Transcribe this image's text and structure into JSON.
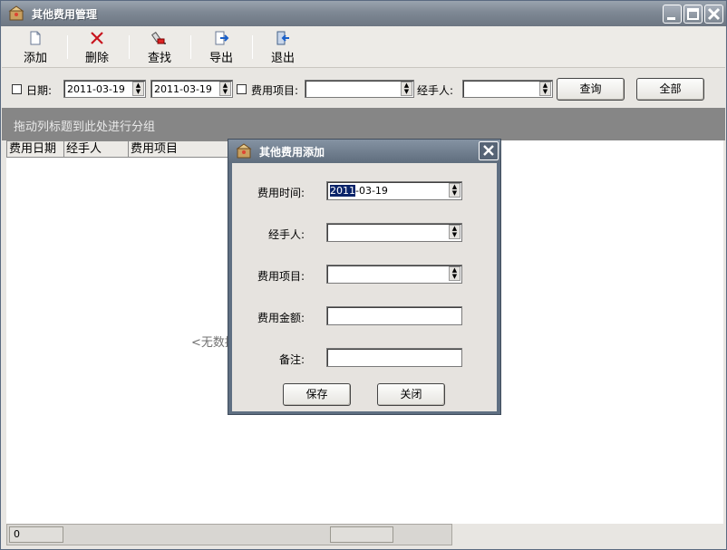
{
  "window": {
    "title": "其他费用管理"
  },
  "toolbar": {
    "add": "添加",
    "delete": "删除",
    "find": "查找",
    "export": "导出",
    "exit": "退出"
  },
  "filter": {
    "date_label": "日期:",
    "date_from": "2011-03-19",
    "date_to": "2011-03-19",
    "item_label": "费用项目:",
    "item_value": "",
    "handler_label": "经手人:",
    "handler_value": "",
    "query_button": "查询",
    "all_button": "全部"
  },
  "group_hint": "拖动列标题到此处进行分组",
  "grid": {
    "columns": [
      "费用日期",
      "经手人",
      "费用项目"
    ],
    "empty_text": "<无数据>"
  },
  "status": {
    "count": "0",
    "panel2": ""
  },
  "dialog": {
    "title": "其他费用添加",
    "time_label": "费用时间:",
    "time_selected": "2011",
    "time_rest": "-03-19",
    "handler_label": "经手人:",
    "handler_value": "",
    "item_label": "费用项目:",
    "item_value": "",
    "amount_label": "费用金额:",
    "amount_value": "",
    "note_label": "备注:",
    "note_value": "",
    "save_button": "保存",
    "close_button": "关闭"
  }
}
